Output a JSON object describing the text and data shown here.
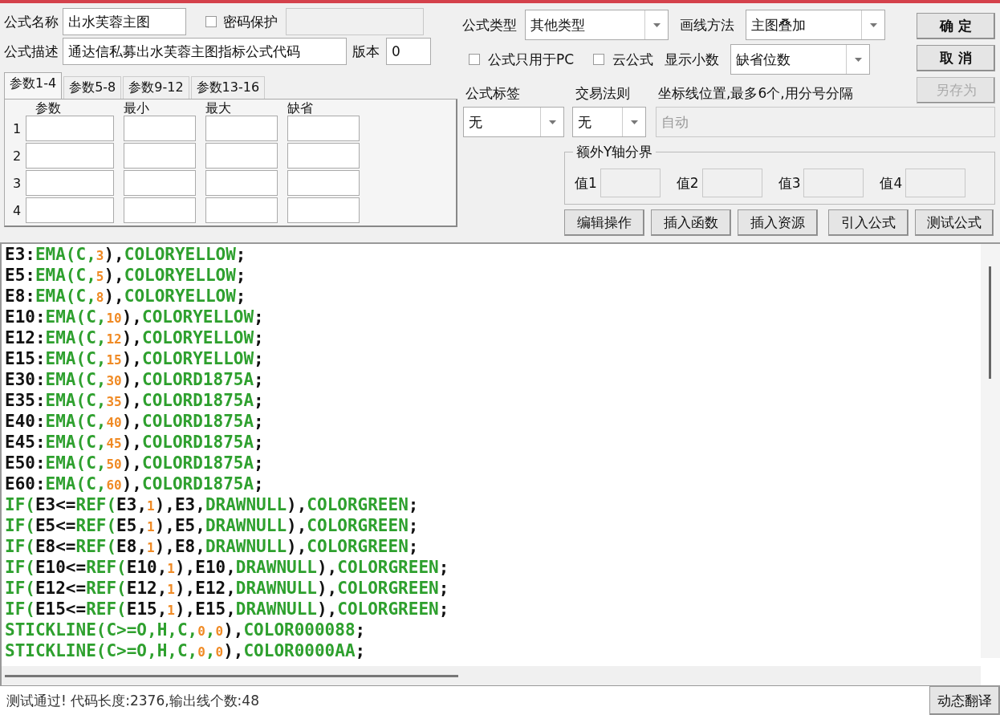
{
  "formula_name": {
    "label": "公式名称",
    "value": "出水芙蓉主图"
  },
  "password_protect": {
    "label": "密码保护",
    "checked": false
  },
  "description": {
    "label": "公式描述",
    "value": "通达信私募出水芙蓉主图指标公式代码"
  },
  "version": {
    "label": "版本",
    "value": "0"
  },
  "param_tabs": [
    {
      "label": "参数1-4",
      "selected": true
    },
    {
      "label": "参数5-8",
      "selected": false
    },
    {
      "label": "参数9-12",
      "selected": false
    },
    {
      "label": "参数13-16",
      "selected": false
    }
  ],
  "param_columns": [
    "参数",
    "最小",
    "最大",
    "缺省"
  ],
  "param_rows": [
    "1",
    "2",
    "3",
    "4"
  ],
  "formula_type": {
    "label": "公式类型",
    "value": "其他类型"
  },
  "draw_method": {
    "label": "画线方法",
    "value": "主图叠加"
  },
  "pc_only": {
    "label": "公式只用于PC",
    "checked": false
  },
  "cloud": {
    "label": "云公式",
    "checked": false
  },
  "decimals": {
    "label": "显示小数",
    "value": "缺省位数"
  },
  "buttons": [
    {
      "label": "确 定",
      "disabled": false
    },
    {
      "label": "取 消",
      "disabled": false
    },
    {
      "label": "另存为",
      "disabled": true
    }
  ],
  "formula_tag": {
    "label": "公式标签",
    "value": "无"
  },
  "trade_rule": {
    "label": "交易法则",
    "value": "无"
  },
  "axis_lines": {
    "label": "坐标线位置,最多6个,用分号分隔",
    "placeholder": "自动",
    "disabled": true
  },
  "extra_y": {
    "title": "额外Y轴分界",
    "fields": [
      "值1",
      "值2",
      "值3",
      "值4"
    ]
  },
  "actions": [
    "编辑操作",
    "插入函数",
    "插入资源",
    "引入公式",
    "测试公式"
  ],
  "code_lines": [
    [
      {
        "kind": "plain",
        "text": "E3:"
      },
      {
        "kind": "keyword",
        "text": "EMA(C,"
      },
      {
        "kind": "number",
        "text": "3"
      },
      {
        "kind": "plain",
        "text": "),"
      },
      {
        "kind": "keyword",
        "text": "COLORYELLOW"
      },
      {
        "kind": "plain",
        "text": ";"
      }
    ],
    [
      {
        "kind": "plain",
        "text": "E5:"
      },
      {
        "kind": "keyword",
        "text": "EMA(C,"
      },
      {
        "kind": "number",
        "text": "5"
      },
      {
        "kind": "plain",
        "text": "),"
      },
      {
        "kind": "keyword",
        "text": "COLORYELLOW"
      },
      {
        "kind": "plain",
        "text": ";"
      }
    ],
    [
      {
        "kind": "plain",
        "text": "E8:"
      },
      {
        "kind": "keyword",
        "text": "EMA(C,"
      },
      {
        "kind": "number",
        "text": "8"
      },
      {
        "kind": "plain",
        "text": "),"
      },
      {
        "kind": "keyword",
        "text": "COLORYELLOW"
      },
      {
        "kind": "plain",
        "text": ";"
      }
    ],
    [
      {
        "kind": "plain",
        "text": "E10:"
      },
      {
        "kind": "keyword",
        "text": "EMA(C,"
      },
      {
        "kind": "number",
        "text": "10"
      },
      {
        "kind": "plain",
        "text": "),"
      },
      {
        "kind": "keyword",
        "text": "COLORYELLOW"
      },
      {
        "kind": "plain",
        "text": ";"
      }
    ],
    [
      {
        "kind": "plain",
        "text": "E12:"
      },
      {
        "kind": "keyword",
        "text": "EMA(C,"
      },
      {
        "kind": "number",
        "text": "12"
      },
      {
        "kind": "plain",
        "text": "),"
      },
      {
        "kind": "keyword",
        "text": "COLORYELLOW"
      },
      {
        "kind": "plain",
        "text": ";"
      }
    ],
    [
      {
        "kind": "plain",
        "text": "E15:"
      },
      {
        "kind": "keyword",
        "text": "EMA(C,"
      },
      {
        "kind": "number",
        "text": "15"
      },
      {
        "kind": "plain",
        "text": "),"
      },
      {
        "kind": "keyword",
        "text": "COLORYELLOW"
      },
      {
        "kind": "plain",
        "text": ";"
      }
    ],
    [
      {
        "kind": "plain",
        "text": "E30:"
      },
      {
        "kind": "keyword",
        "text": "EMA(C,"
      },
      {
        "kind": "number",
        "text": "30"
      },
      {
        "kind": "plain",
        "text": "),"
      },
      {
        "kind": "keyword",
        "text": "COLORD1875A"
      },
      {
        "kind": "plain",
        "text": ";"
      }
    ],
    [
      {
        "kind": "plain",
        "text": "E35:"
      },
      {
        "kind": "keyword",
        "text": "EMA(C,"
      },
      {
        "kind": "number",
        "text": "35"
      },
      {
        "kind": "plain",
        "text": "),"
      },
      {
        "kind": "keyword",
        "text": "COLORD1875A"
      },
      {
        "kind": "plain",
        "text": ";"
      }
    ],
    [
      {
        "kind": "plain",
        "text": "E40:"
      },
      {
        "kind": "keyword",
        "text": "EMA(C,"
      },
      {
        "kind": "number",
        "text": "40"
      },
      {
        "kind": "plain",
        "text": "),"
      },
      {
        "kind": "keyword",
        "text": "COLORD1875A"
      },
      {
        "kind": "plain",
        "text": ";"
      }
    ],
    [
      {
        "kind": "plain",
        "text": "E45:"
      },
      {
        "kind": "keyword",
        "text": "EMA(C,"
      },
      {
        "kind": "number",
        "text": "45"
      },
      {
        "kind": "plain",
        "text": "),"
      },
      {
        "kind": "keyword",
        "text": "COLORD1875A"
      },
      {
        "kind": "plain",
        "text": ";"
      }
    ],
    [
      {
        "kind": "plain",
        "text": "E50:"
      },
      {
        "kind": "keyword",
        "text": "EMA(C,"
      },
      {
        "kind": "number",
        "text": "50"
      },
      {
        "kind": "plain",
        "text": "),"
      },
      {
        "kind": "keyword",
        "text": "COLORD1875A"
      },
      {
        "kind": "plain",
        "text": ";"
      }
    ],
    [
      {
        "kind": "plain",
        "text": "E60:"
      },
      {
        "kind": "keyword",
        "text": "EMA(C,"
      },
      {
        "kind": "number",
        "text": "60"
      },
      {
        "kind": "plain",
        "text": "),"
      },
      {
        "kind": "keyword",
        "text": "COLORD1875A"
      },
      {
        "kind": "plain",
        "text": ";"
      }
    ],
    [
      {
        "kind": "keyword",
        "text": "IF("
      },
      {
        "kind": "plain",
        "text": "E3<="
      },
      {
        "kind": "keyword",
        "text": "REF("
      },
      {
        "kind": "plain",
        "text": "E3,"
      },
      {
        "kind": "number",
        "text": "1"
      },
      {
        "kind": "plain",
        "text": "),E3,"
      },
      {
        "kind": "keyword",
        "text": "DRAWNULL"
      },
      {
        "kind": "plain",
        "text": "),"
      },
      {
        "kind": "keyword",
        "text": "COLORGREEN"
      },
      {
        "kind": "plain",
        "text": ";"
      }
    ],
    [
      {
        "kind": "keyword",
        "text": "IF("
      },
      {
        "kind": "plain",
        "text": "E5<="
      },
      {
        "kind": "keyword",
        "text": "REF("
      },
      {
        "kind": "plain",
        "text": "E5,"
      },
      {
        "kind": "number",
        "text": "1"
      },
      {
        "kind": "plain",
        "text": "),E5,"
      },
      {
        "kind": "keyword",
        "text": "DRAWNULL"
      },
      {
        "kind": "plain",
        "text": "),"
      },
      {
        "kind": "keyword",
        "text": "COLORGREEN"
      },
      {
        "kind": "plain",
        "text": ";"
      }
    ],
    [
      {
        "kind": "keyword",
        "text": "IF("
      },
      {
        "kind": "plain",
        "text": "E8<="
      },
      {
        "kind": "keyword",
        "text": "REF("
      },
      {
        "kind": "plain",
        "text": "E8,"
      },
      {
        "kind": "number",
        "text": "1"
      },
      {
        "kind": "plain",
        "text": "),E8,"
      },
      {
        "kind": "keyword",
        "text": "DRAWNULL"
      },
      {
        "kind": "plain",
        "text": "),"
      },
      {
        "kind": "keyword",
        "text": "COLORGREEN"
      },
      {
        "kind": "plain",
        "text": ";"
      }
    ],
    [
      {
        "kind": "keyword",
        "text": "IF("
      },
      {
        "kind": "plain",
        "text": "E10<="
      },
      {
        "kind": "keyword",
        "text": "REF("
      },
      {
        "kind": "plain",
        "text": "E10,"
      },
      {
        "kind": "number",
        "text": "1"
      },
      {
        "kind": "plain",
        "text": "),E10,"
      },
      {
        "kind": "keyword",
        "text": "DRAWNULL"
      },
      {
        "kind": "plain",
        "text": "),"
      },
      {
        "kind": "keyword",
        "text": "COLORGREEN"
      },
      {
        "kind": "plain",
        "text": ";"
      }
    ],
    [
      {
        "kind": "keyword",
        "text": "IF("
      },
      {
        "kind": "plain",
        "text": "E12<="
      },
      {
        "kind": "keyword",
        "text": "REF("
      },
      {
        "kind": "plain",
        "text": "E12,"
      },
      {
        "kind": "number",
        "text": "1"
      },
      {
        "kind": "plain",
        "text": "),E12,"
      },
      {
        "kind": "keyword",
        "text": "DRAWNULL"
      },
      {
        "kind": "plain",
        "text": "),"
      },
      {
        "kind": "keyword",
        "text": "COLORGREEN"
      },
      {
        "kind": "plain",
        "text": ";"
      }
    ],
    [
      {
        "kind": "keyword",
        "text": "IF("
      },
      {
        "kind": "plain",
        "text": "E15<="
      },
      {
        "kind": "keyword",
        "text": "REF("
      },
      {
        "kind": "plain",
        "text": "E15,"
      },
      {
        "kind": "number",
        "text": "1"
      },
      {
        "kind": "plain",
        "text": "),E15,"
      },
      {
        "kind": "keyword",
        "text": "DRAWNULL"
      },
      {
        "kind": "plain",
        "text": "),"
      },
      {
        "kind": "keyword",
        "text": "COLORGREEN"
      },
      {
        "kind": "plain",
        "text": ";"
      }
    ],
    [
      {
        "kind": "keyword",
        "text": "STICKLINE(C>=O,H,C,"
      },
      {
        "kind": "number",
        "text": "0"
      },
      {
        "kind": "keyword",
        "text": ","
      },
      {
        "kind": "number",
        "text": "0"
      },
      {
        "kind": "plain",
        "text": "),"
      },
      {
        "kind": "keyword",
        "text": "COLOR000088"
      },
      {
        "kind": "plain",
        "text": ";"
      }
    ],
    [
      {
        "kind": "keyword",
        "text": "STICKLINE(C>=O,H,C,"
      },
      {
        "kind": "number",
        "text": "0"
      },
      {
        "kind": "keyword",
        "text": ","
      },
      {
        "kind": "number",
        "text": "0"
      },
      {
        "kind": "plain",
        "text": "),"
      },
      {
        "kind": "keyword",
        "text": "COLOR0000AA"
      },
      {
        "kind": "plain",
        "text": ";"
      }
    ]
  ],
  "status": "测试通过! 代码长度:2376,输出线个数:48",
  "translate_button": "动态翻译"
}
